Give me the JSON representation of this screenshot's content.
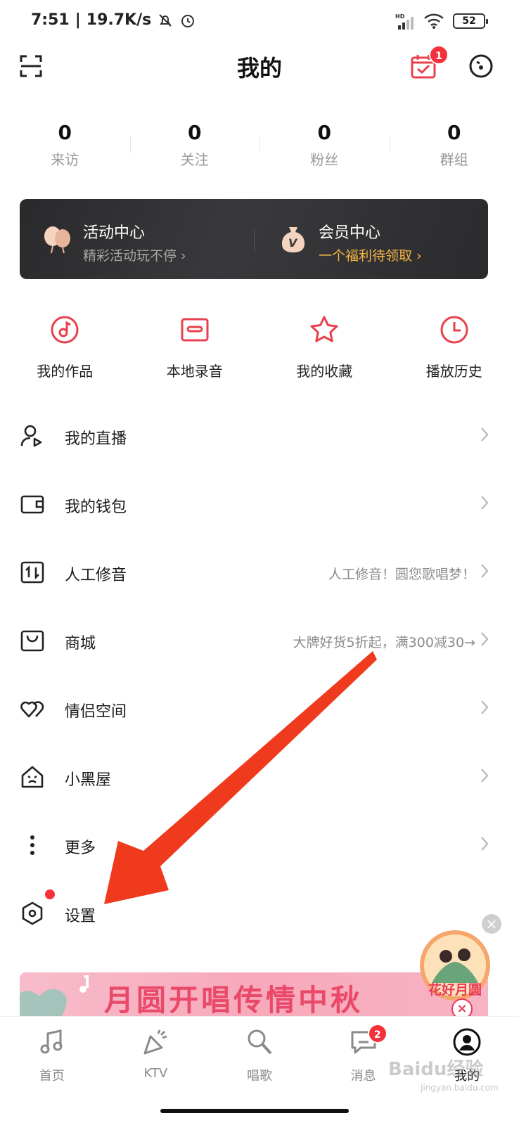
{
  "status_bar": {
    "time": "7:51",
    "speed": "19.7K/s",
    "network": "HD",
    "battery": "52"
  },
  "header": {
    "title": "我的",
    "calendar_badge": "1"
  },
  "stats": [
    {
      "value": "0",
      "label": "来访"
    },
    {
      "value": "0",
      "label": "关注"
    },
    {
      "value": "0",
      "label": "粉丝"
    },
    {
      "value": "0",
      "label": "群组"
    }
  ],
  "promo": {
    "activity": {
      "title": "活动中心",
      "subtitle": "精彩活动玩不停 ›"
    },
    "vip": {
      "title": "会员中心",
      "subtitle": "一个福利待领取 ›"
    }
  },
  "quick_actions": [
    {
      "label": "我的作品",
      "icon": "music-disc-icon"
    },
    {
      "label": "本地录音",
      "icon": "cassette-icon"
    },
    {
      "label": "我的收藏",
      "icon": "star-icon"
    },
    {
      "label": "播放历史",
      "icon": "clock-icon"
    }
  ],
  "menu": [
    {
      "label": "我的直播",
      "sub": "",
      "icon": "live-user-icon"
    },
    {
      "label": "我的钱包",
      "sub": "",
      "icon": "wallet-icon"
    },
    {
      "label": "人工修音",
      "sub": "人工修音！圆您歌唱梦！",
      "icon": "tuning-icon"
    },
    {
      "label": "商城",
      "sub": "大牌好货5折起，满300减30→",
      "icon": "shopping-bag-icon"
    },
    {
      "label": "情侣空间",
      "sub": "",
      "icon": "hearts-icon"
    },
    {
      "label": "小黑屋",
      "sub": "",
      "icon": "house-icon"
    },
    {
      "label": "更多",
      "sub": "",
      "icon": "more-vertical-icon"
    },
    {
      "label": "设置",
      "sub": "",
      "icon": "settings-hexagon-icon"
    }
  ],
  "bottom_banner": {
    "text": "月圆开唱传情中秋",
    "float_badge_text": "花好月圆"
  },
  "tabs": [
    {
      "label": "首页",
      "icon": "music-note-icon"
    },
    {
      "label": "KTV",
      "icon": "party-icon"
    },
    {
      "label": "唱歌",
      "icon": "microphone-icon"
    },
    {
      "label": "消息",
      "icon": "message-icon",
      "badge": "2"
    },
    {
      "label": "我的",
      "icon": "profile-icon",
      "active": true
    }
  ],
  "watermark": {
    "text": "Baidu经验",
    "sub": "jingyan.baidu.com"
  },
  "colors": {
    "accent": "#e8404e",
    "badge": "#f5323c",
    "gold": "#f2b544",
    "arrow": "#f03a1d"
  }
}
